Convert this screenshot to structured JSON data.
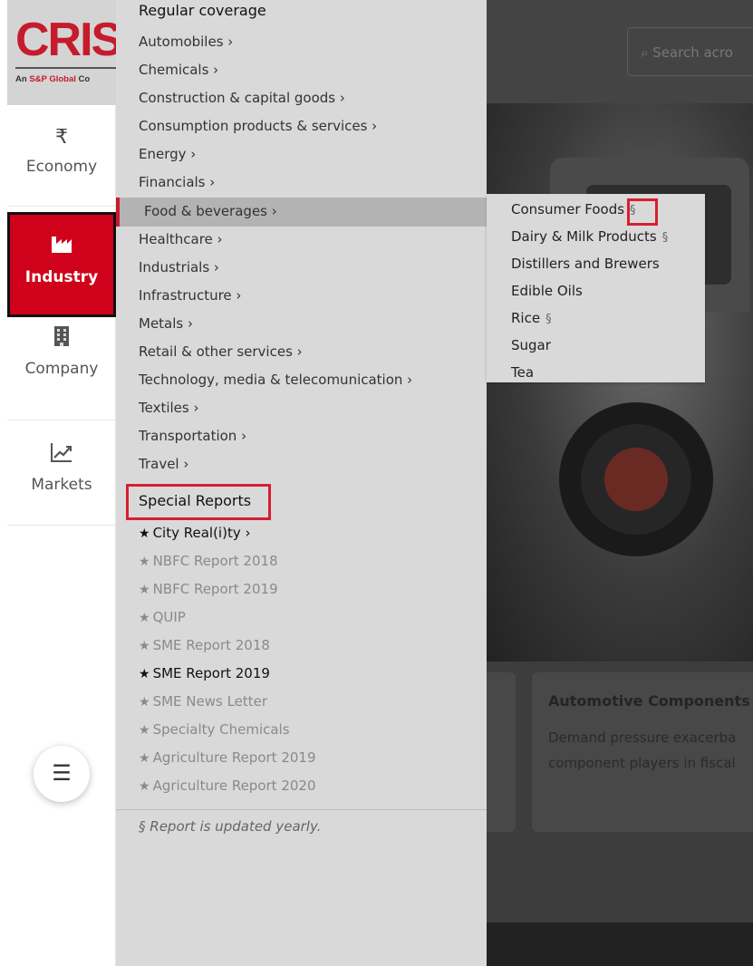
{
  "logo": {
    "text": "CRIS",
    "sub_prefix": "An ",
    "sub_brand": "S&P Global",
    "sub_suffix": " Co"
  },
  "nav": {
    "economy": {
      "label": "Economy",
      "icon": "rupee-icon",
      "glyph": "₹"
    },
    "industry": {
      "label": "Industry",
      "icon": "factory-icon"
    },
    "company": {
      "label": "Company",
      "icon": "building-icon"
    },
    "markets": {
      "label": "Markets",
      "icon": "chart-line-icon"
    }
  },
  "menu_button": {
    "icon": "hamburger-menu-icon",
    "glyph": "☰"
  },
  "panel": {
    "regular_heading": "Regular coverage",
    "regular_items": [
      "Automobiles ›",
      "Chemicals ›",
      "Construction & capital goods ›",
      "Consumption products & services ›",
      "Energy ›",
      "Financials ›",
      "Food & beverages ›",
      "Healthcare ›",
      "Industrials ›",
      "Infrastructure ›",
      "Metals ›",
      "Retail & other services ›",
      "Technology, media & telecomunication ›",
      "Textiles ›",
      "Transportation ›",
      "Travel ›"
    ],
    "special_heading": "Special Reports",
    "special_items": [
      {
        "label": "City Real(i)ty ›",
        "style": "dark"
      },
      {
        "label": "NBFC Report 2018",
        "style": "light"
      },
      {
        "label": "NBFC Report 2019",
        "style": "light"
      },
      {
        "label": "QUIP",
        "style": "light"
      },
      {
        "label": "SME Report 2018",
        "style": "light"
      },
      {
        "label": "SME Report 2019",
        "style": "dark"
      },
      {
        "label": "SME News Letter",
        "style": "light"
      },
      {
        "label": "Specialty Chemicals",
        "style": "light"
      },
      {
        "label": "Agriculture Report 2019",
        "style": "light"
      },
      {
        "label": "Agriculture Report 2020",
        "style": "light"
      }
    ],
    "note_icon": "§",
    "note": "Report is updated yearly."
  },
  "submenu": {
    "items": [
      {
        "label": "Consumer Foods",
        "yearly": true
      },
      {
        "label": "Dairy & Milk Products",
        "yearly": true
      },
      {
        "label": "Distillers and Brewers",
        "yearly": false
      },
      {
        "label": "Edible Oils",
        "yearly": false
      },
      {
        "label": "Rice",
        "yearly": true
      },
      {
        "label": "Sugar",
        "yearly": false
      },
      {
        "label": "Tea",
        "yearly": false
      }
    ],
    "yearly_glyph": "§"
  },
  "background": {
    "search_placeholder": "Search acro",
    "card_title": "Automotive Components",
    "card_line1": "Demand pressure exacerba",
    "card_line2": "component players in fiscal"
  },
  "colors": {
    "brand_red": "#d0021b",
    "panel_bg": "#d9d9d9",
    "highlight_red": "#d61f32"
  }
}
